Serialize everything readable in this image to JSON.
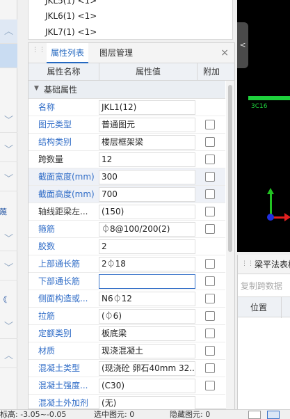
{
  "top_list": {
    "items": [
      "JKL5(1) <1>",
      "JKL6(1) <1>",
      "JKL7(1) <1>"
    ]
  },
  "left_strip": {
    "tag_a": "蔑",
    "tag_b": "《"
  },
  "panel": {
    "tabs": [
      {
        "label": "属性列表",
        "active": true
      },
      {
        "label": "图层管理",
        "active": false
      }
    ],
    "close_glyph": "×",
    "columns": {
      "name": "属性名称",
      "value": "属性值",
      "extra": "附加"
    },
    "group_label": "基础属性",
    "rows": [
      {
        "name": "名称",
        "value": "JKL1(12)",
        "checkbox": false,
        "name_color": "blue"
      },
      {
        "name": "图元类型",
        "value": "普通图元",
        "checkbox": true,
        "name_color": "blue"
      },
      {
        "name": "结构类别",
        "value": "楼层框架梁",
        "checkbox": true,
        "name_color": "blue"
      },
      {
        "name": "跨数量",
        "value": "12",
        "checkbox": true,
        "name_color": "dark"
      },
      {
        "name": "截面宽度(mm)",
        "value": "300",
        "checkbox": true,
        "name_color": "blue",
        "shade": true
      },
      {
        "name": "截面高度(mm)",
        "value": "700",
        "checkbox": true,
        "name_color": "blue",
        "shade": true
      },
      {
        "name": "轴线距梁左...",
        "value": "(150)",
        "checkbox": true,
        "name_color": "dark"
      },
      {
        "name": "箍筋",
        "value": "⏀8@100/200(2)",
        "checkbox": true,
        "name_color": "blue"
      },
      {
        "name": "胶数",
        "value": "2",
        "checkbox": false,
        "name_color": "blue"
      },
      {
        "name": "上部通长筋",
        "value": "2⏀18",
        "checkbox": true,
        "name_color": "blue"
      },
      {
        "name": "下部通长筋",
        "value": "",
        "checkbox": true,
        "name_color": "blue",
        "active": true
      },
      {
        "name": "侧面构造或...",
        "value": "N6⏀12",
        "checkbox": true,
        "name_color": "blue"
      },
      {
        "name": "拉筋",
        "value": "(⏀6)",
        "checkbox": true,
        "name_color": "blue"
      },
      {
        "name": "定额类别",
        "value": "板底梁",
        "checkbox": true,
        "name_color": "blue"
      },
      {
        "name": "材质",
        "value": "现浇混凝土",
        "checkbox": true,
        "name_color": "blue"
      },
      {
        "name": "混凝土类型",
        "value": "(现浇砼 卵石40mm 32...",
        "checkbox": true,
        "name_color": "blue"
      },
      {
        "name": "混凝土强度...",
        "value": "(C30)",
        "checkbox": true,
        "name_color": "blue"
      },
      {
        "name": "混凝土外加剂",
        "value": "(无)",
        "checkbox": false,
        "name_color": "blue"
      }
    ]
  },
  "viewport": {
    "beam_label": "3C16",
    "collapse_glyph": "<"
  },
  "right_panel": {
    "title": "梁平法表格",
    "copy_label": "复制跨数据",
    "col1": "位置"
  },
  "status": {
    "elevation": "标高: -3.05~-0.05",
    "selected": "选中图元: 0",
    "hidden": "隐藏图元: 0"
  },
  "colors": {
    "accent": "#2468c0",
    "beam": "#1ed13c",
    "axis_x": "#e02020",
    "axis_z": "#22c322",
    "axis_origin": "#2030e0"
  }
}
